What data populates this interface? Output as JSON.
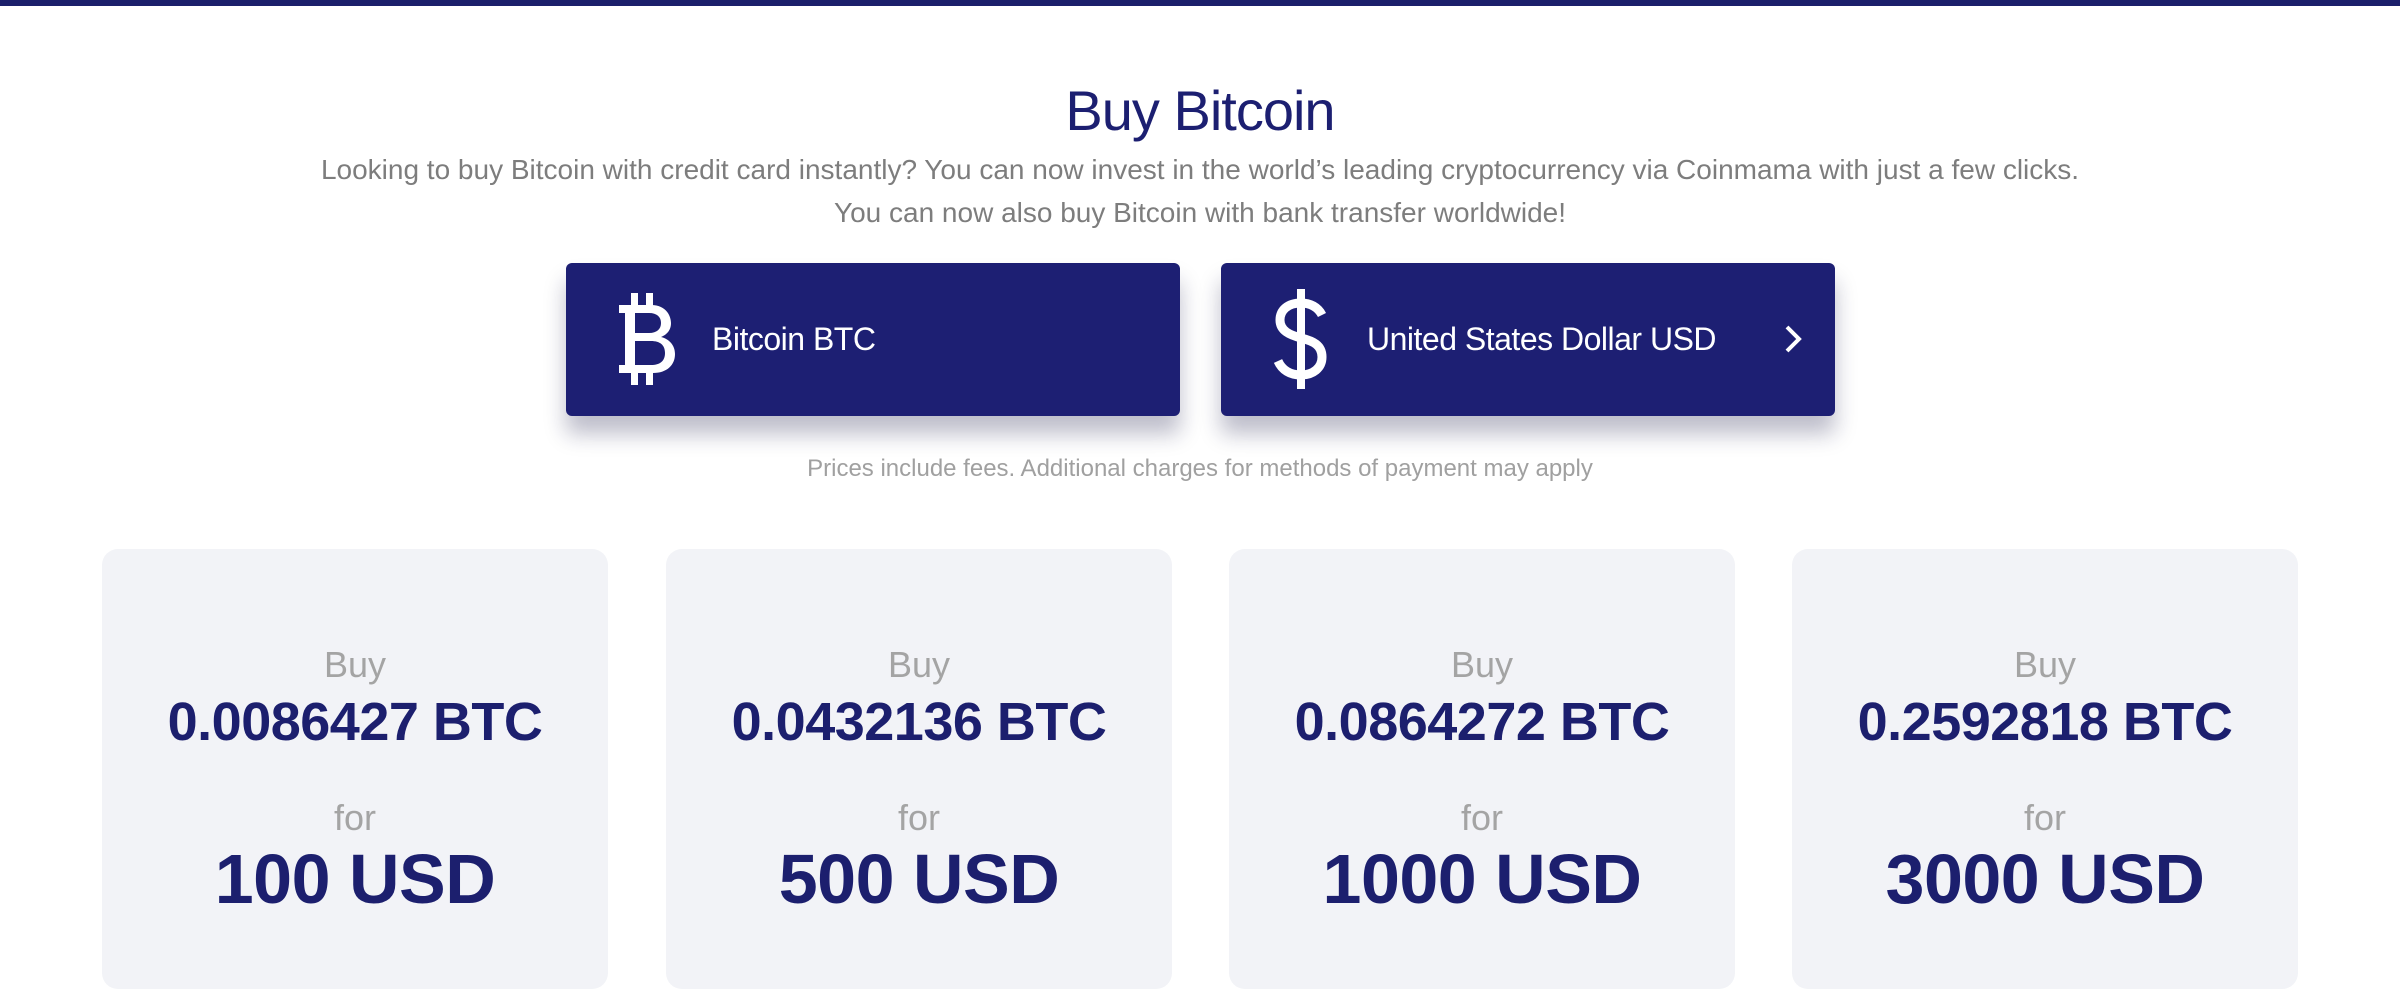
{
  "colors": {
    "accent": "#1c1f71",
    "top_bar": "#1b1f6b",
    "card_bg": "#f2f3f7",
    "muted_text": "#7d7d7d"
  },
  "header": {
    "title": "Buy Bitcoin"
  },
  "intro": {
    "line1": "Looking to buy Bitcoin with credit card instantly? You can now invest in the world’s leading cryptocurrency via Coinmama with just a few clicks.",
    "line2": "You can now also buy Bitcoin with bank transfer worldwide!"
  },
  "selectors": {
    "crypto": {
      "icon": "bitcoin-icon",
      "label": "Bitcoin BTC"
    },
    "fiat": {
      "icon": "dollar-icon",
      "label": "United States Dollar USD",
      "chevron_icon": "chevron-right-icon"
    }
  },
  "fees_note": "Prices include fees. Additional charges for methods of payment may apply",
  "offers": [
    {
      "buy_label": "Buy",
      "amount": "0.0086427 BTC",
      "for_label": "for",
      "price": "100 USD"
    },
    {
      "buy_label": "Buy",
      "amount": "0.0432136 BTC",
      "for_label": "for",
      "price": "500 USD"
    },
    {
      "buy_label": "Buy",
      "amount": "0.0864272 BTC",
      "for_label": "for",
      "price": "1000 USD"
    },
    {
      "buy_label": "Buy",
      "amount": "0.2592818 BTC",
      "for_label": "for",
      "price": "3000 USD"
    }
  ]
}
